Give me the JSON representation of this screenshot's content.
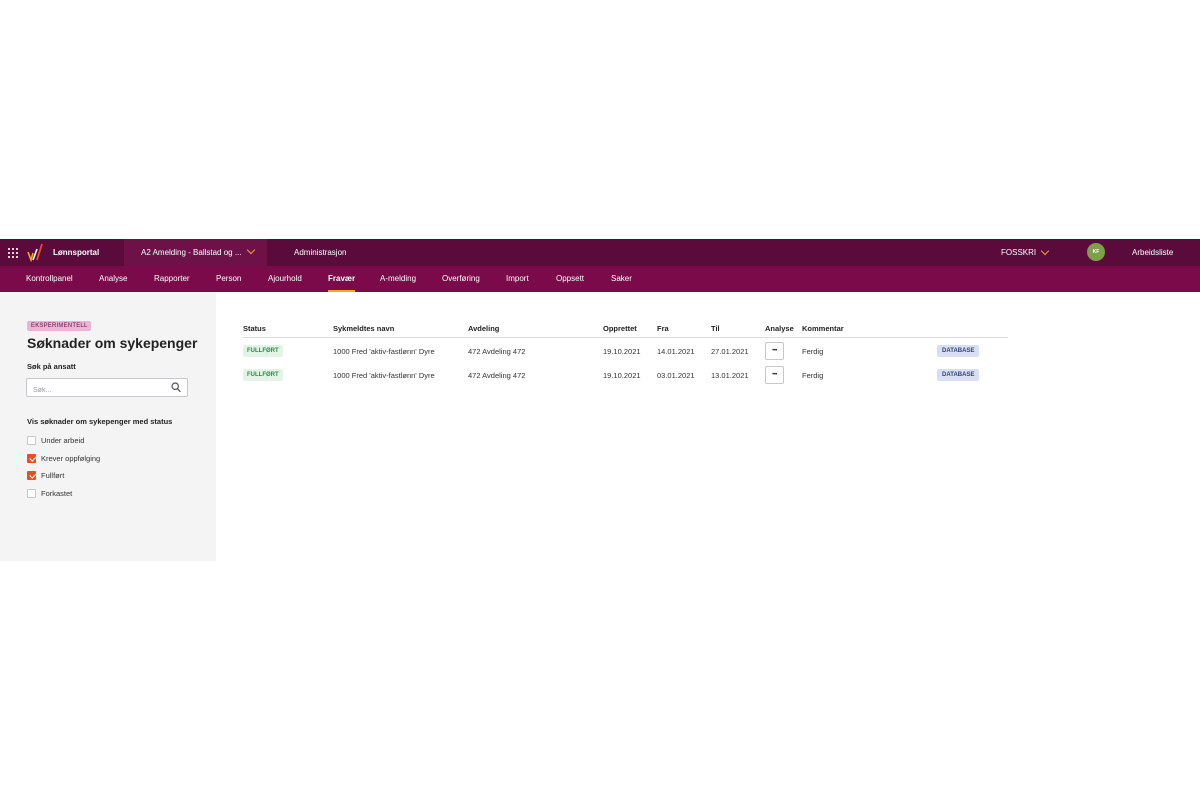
{
  "topbar": {
    "app_name": "Lønnsportal",
    "company": "A2 Amelding - Ballstad og ...",
    "admin": "Administrasjon",
    "user": "FOSSKRI",
    "avatar_initials": "KF",
    "worklist": "Arbeidsliste",
    "icons": {
      "apps": "grid-icon",
      "logo": "logo-icon",
      "dropdown": "chevron-down-icon"
    }
  },
  "nav": [
    {
      "label": "Kontrollpanel",
      "active": false
    },
    {
      "label": "Analyse",
      "active": false
    },
    {
      "label": "Rapporter",
      "active": false
    },
    {
      "label": "Person",
      "active": false
    },
    {
      "label": "Ajourhold",
      "active": false
    },
    {
      "label": "Fravær",
      "active": true
    },
    {
      "label": "A-melding",
      "active": false
    },
    {
      "label": "Overføring",
      "active": false
    },
    {
      "label": "Import",
      "active": false
    },
    {
      "label": "Oppsett",
      "active": false
    },
    {
      "label": "Saker",
      "active": false
    }
  ],
  "sidebar": {
    "badge": "EKSPERIMENTELL",
    "title": "Søknader om sykepenger",
    "search_label": "Søk på ansatt",
    "search_placeholder": "Søk...",
    "status_filter_label": "Vis søknader om sykepenger med status",
    "filters": [
      {
        "label": "Under arbeid",
        "checked": false
      },
      {
        "label": "Krever oppfølging",
        "checked": true
      },
      {
        "label": "Fullført",
        "checked": true
      },
      {
        "label": "Forkastet",
        "checked": false
      }
    ]
  },
  "table": {
    "headers": {
      "status": "Status",
      "name": "Sykmeldtes navn",
      "dept": "Avdeling",
      "created": "Opprettet",
      "from": "Fra",
      "to": "Til",
      "analysis": "Analyse",
      "comment": "Kommentar"
    },
    "rows": [
      {
        "status": "FULLFØRT",
        "name": "1000 Fred 'aktiv-fastlønn' Dyre",
        "dept": "472 Avdeling 472",
        "created": "19.10.2021",
        "from": "14.01.2021",
        "to": "27.01.2021",
        "analysis": "•••",
        "comment": "Ferdig",
        "source": "DATABASE"
      },
      {
        "status": "FULLFØRT",
        "name": "1000 Fred 'aktiv-fastlønn' Dyre",
        "dept": "472 Avdeling 472",
        "created": "19.10.2021",
        "from": "03.01.2021",
        "to": "13.01.2021",
        "analysis": "•••",
        "comment": "Ferdig",
        "source": "DATABASE"
      }
    ]
  },
  "colors": {
    "topbar": "#5a0a3b",
    "navbar": "#7a0a4a",
    "accent": "#f5a623",
    "checkbox_checked": "#e8501e",
    "status_green": "#2e8b4a"
  }
}
